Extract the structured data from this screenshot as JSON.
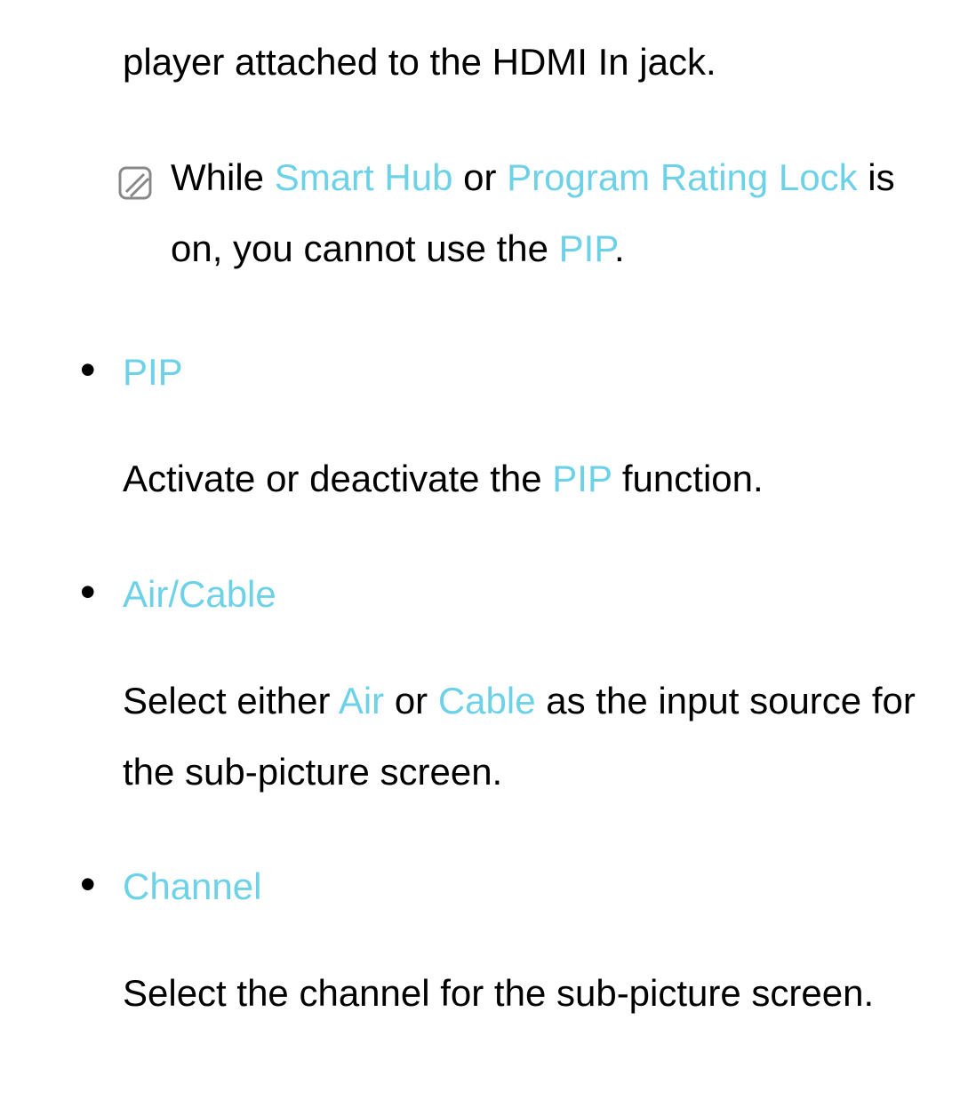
{
  "intro_line": "player attached to the HDMI In jack.",
  "note": {
    "parts": [
      {
        "text": "While ",
        "hl": false
      },
      {
        "text": "Smart Hub",
        "hl": true
      },
      {
        "text": " or ",
        "hl": false
      },
      {
        "text": "Program Rating Lock",
        "hl": true
      },
      {
        "text": " is on, you cannot use the ",
        "hl": false
      },
      {
        "text": "PIP",
        "hl": true
      },
      {
        "text": ".",
        "hl": false
      }
    ]
  },
  "items": [
    {
      "title": "PIP",
      "desc_parts": [
        {
          "text": "Activate or deactivate the ",
          "hl": false
        },
        {
          "text": "PIP",
          "hl": true
        },
        {
          "text": " function.",
          "hl": false
        }
      ]
    },
    {
      "title": "Air/Cable",
      "desc_parts": [
        {
          "text": "Select either ",
          "hl": false
        },
        {
          "text": "Air",
          "hl": true
        },
        {
          "text": " or ",
          "hl": false
        },
        {
          "text": "Cable",
          "hl": true
        },
        {
          "text": " as the input source for the sub-picture screen.",
          "hl": false
        }
      ]
    },
    {
      "title": "Channel",
      "desc_parts": [
        {
          "text": "Select the channel for the sub-picture screen.",
          "hl": false
        }
      ]
    }
  ]
}
